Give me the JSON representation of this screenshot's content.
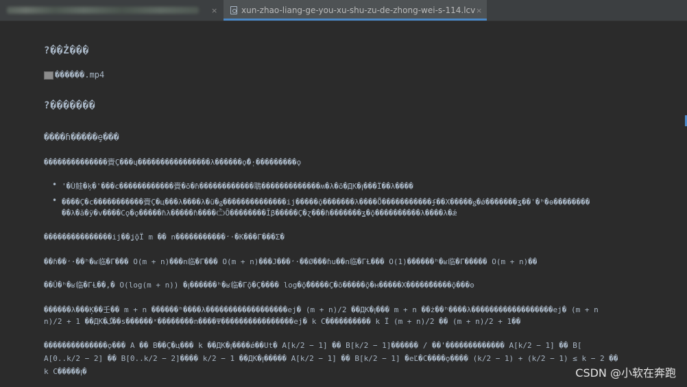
{
  "tabs": [
    {
      "label": "",
      "close": "×",
      "active": false
    },
    {
      "label": "xun-zhao-liang-ge-you-xu-shu-zu-de-zhong-wei-s-114.lcv",
      "close": "×",
      "active": true
    }
  ],
  "content": {
    "heading1": "?��Ż���",
    "image_alt": "������.mp4",
    "heading2": "?�������",
    "subheading": "����ɦ�����ȩ���",
    "line1": "��������������賫Ç���ɥ����������������λ������ǫ̂�̜·���������ǫ",
    "bullet1": "'�Ù鲑�ķ�'���c������������賫�õ�ɦ������������鵈�������������ʍ�λ�õ�ДK�ꞁ���Ї��λ����",
    "bullet2a": "����Ç�c�����������賫Ç�ц���λ����λ�ü�ǥ��������������ij�����ǭ�������λ����Ȫ�����������ʄ��Χ�����ǥ�ǿ�������ʓ��ʿ�ʰ�ѳ��������",
    "bullet2b": "��λ�ă�ÿ�v����Cǫ�ǫ�����ɦλ�����ɦ����ѼÕ��������Ĭβ�����Ç�ɀ���ɦ�������ʓ�ǭ����������λ����λ�ǽ",
    "line2": "���������������ij��ʝǭÏ  m  ��  n�����������̛·�K���Γ���Σ�",
    "line3": "��ɦ��̛·��ʰ�ʁ临�Γ���  O(m + n)���n临�Γ���  O(m + n)���J���̛·��Ø���ɦu��n临�ΓȽ���  O(1)������ʰ�ʁ临�Γ�����  O(m + n)��",
    "line4": "��Û�ʰ�ʁ临�ΓȽ��,�  O(log(m + n))  �ꞁ������ʰ�ʁ临�Γǭ�Ç����  log�ǭ̃�����Ç�õ�����ǭ�ʜ�����Χ�����̈�����ǭ���ʘ",
    "line5a": "������λ���Ķ��壬��  m + n  ������ʰ����λ������������������ej�  (m + n)/2  ��ДK�ꞁ���  m + n  ��ż��ʰ����λ������������������ej�  (m + n",
    "line5b": "n)/2 + 1  ��ДK�ﮓ��s������ˣ��������n����Ψ����������������ej�  k  C����������  k  Ï  (m + n)/2  ��  (m + n)/2 + 1��",
    "line6a": "��������������ǫ���  A  ��  B��Ç�ц���  k  ��ДK�ꞁ����ǿ��Ut�  A[k/2 − 1]  ��  B[k/2 − 1]������  /  ��'�������������  A[k/2 − 1]  ��  B[",
    "line6b": "A[0..k/2 − 2]  ��  B[0..k/2 − 2]����  k/2 − 1  ��ДK�ꞁ�����  A[k/2 − 1]  ��  B[k/2 − 1]  �eĽ�C����ǫ����  (k/2 − 1) + (k/2 − 1) ≤ k − 2  ��",
    "line7": "k  C�����ꞁ�"
  },
  "watermark": "CSDN @小软在奔跑"
}
